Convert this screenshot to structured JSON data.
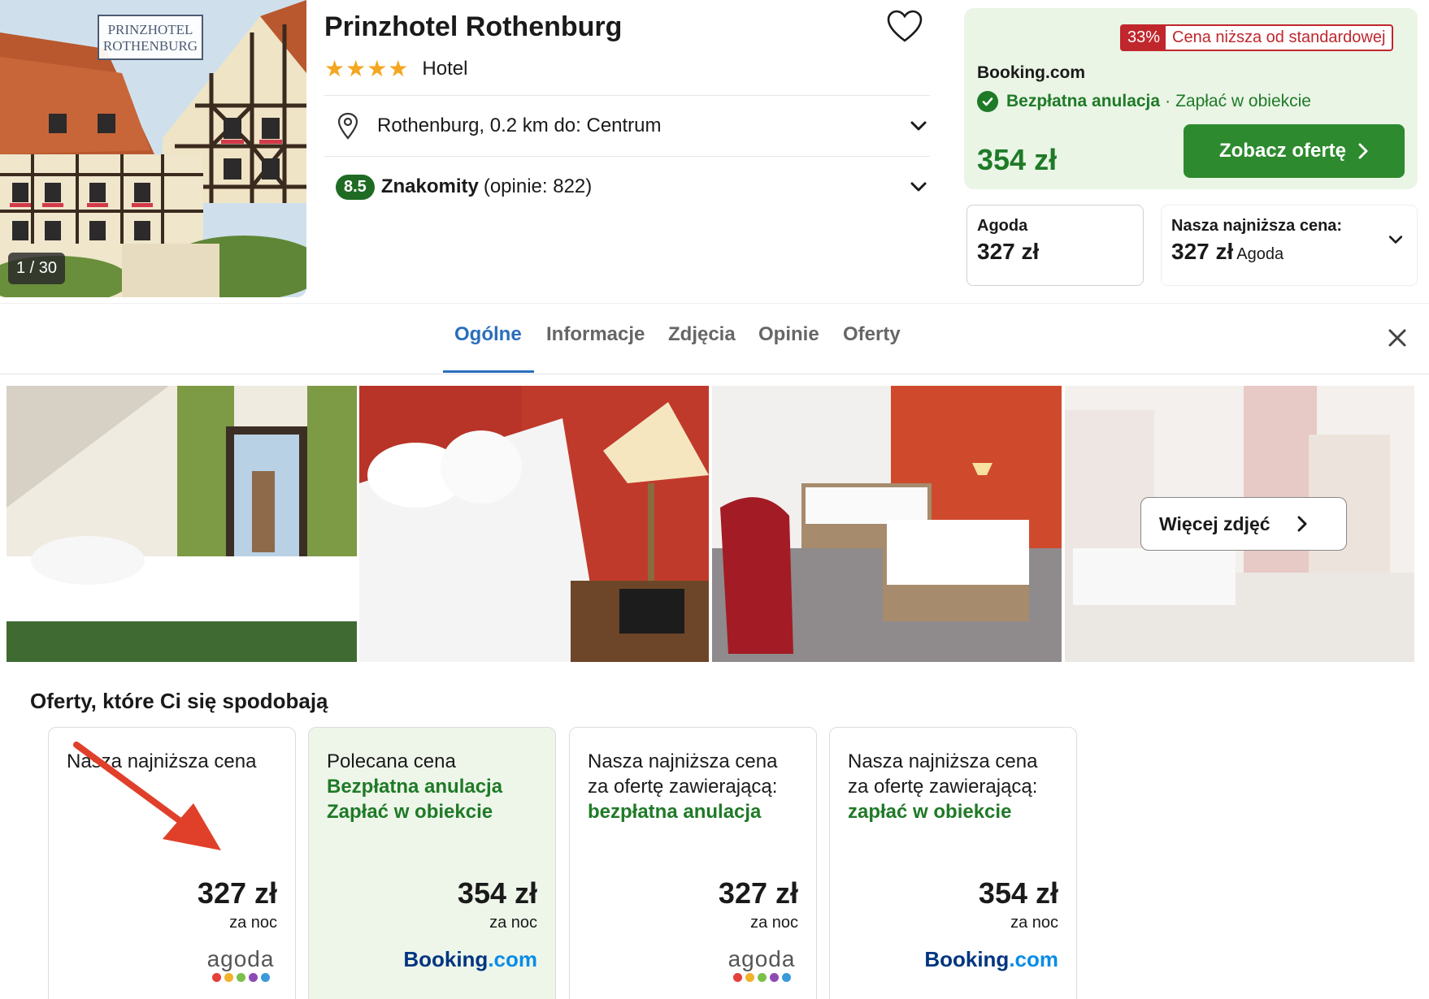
{
  "hero": {
    "logo_line1": "PRINZHOTEL",
    "logo_line2": "ROTHENBURG",
    "photo_counter": "1 / 30"
  },
  "hotel": {
    "name": "Prinzhotel Rothenburg",
    "stars": "★★★★",
    "star_count": 4,
    "type": "Hotel",
    "location": "Rothenburg, 0.2 km do: Centrum",
    "rating_score": "8.5",
    "rating_word": "Znakomity",
    "rating_count": "(opinie: 822)"
  },
  "price_box": {
    "discount_pct": "33%",
    "discount_text": "Cena niższa od standardowej",
    "provider": "Booking.com",
    "free_cancel": "Bezpłatna anulacja",
    "separator": "·",
    "pay_at_hotel": "Zapłać w obiekcie",
    "price": "354 zł",
    "cta": "Zobacz ofertę",
    "alt_provider": "Agoda",
    "alt_price": "327 zł",
    "lowest_label": "Nasza najniższa cena:",
    "lowest_price": "327 zł",
    "lowest_provider": "Agoda"
  },
  "tabs": [
    "Ogólne",
    "Informacje",
    "Zdjęcia",
    "Opinie",
    "Oferty"
  ],
  "gallery": {
    "more_label": "Więcej zdjęć"
  },
  "offers": {
    "title": "Oferty, które Ci się spodobają",
    "cards": [
      {
        "line1": "Nasza najniższa cena",
        "line2": "",
        "line3": "",
        "price": "327 zł",
        "per": "za noc",
        "provider": "agoda"
      },
      {
        "line1": "Polecana cena",
        "line2": "Bezpłatna anulacja",
        "line3": "Zapłać w obiekcie",
        "price": "354 zł",
        "per": "za noc",
        "provider": "booking"
      },
      {
        "line1": "Nasza najniższa cena",
        "line2": "za ofertę zawierającą:",
        "line3": "bezpłatna anulacja",
        "price": "327 zł",
        "per": "za noc",
        "provider": "agoda"
      },
      {
        "line1": "Nasza najniższa cena",
        "line2": "za ofertę zawierającą:",
        "line3": "zapłać w obiekcie",
        "price": "354 zł",
        "per": "za noc",
        "provider": "booking"
      }
    ],
    "agoda_word": "agoda",
    "booking_word_a": "Booking",
    "booking_word_b": ".com"
  },
  "colors": {
    "accent_green": "#1f7a27",
    "button_green": "#2d8a2e",
    "tab_blue": "#2a6ebb",
    "discount_red": "#c0272d",
    "annotation_red": "#e0402a"
  },
  "icons": [
    "heart-icon",
    "map-pin-icon",
    "chevron-down-icon",
    "check-circle-icon",
    "chevron-right-icon",
    "close-icon",
    "red-arrow-annotation"
  ]
}
